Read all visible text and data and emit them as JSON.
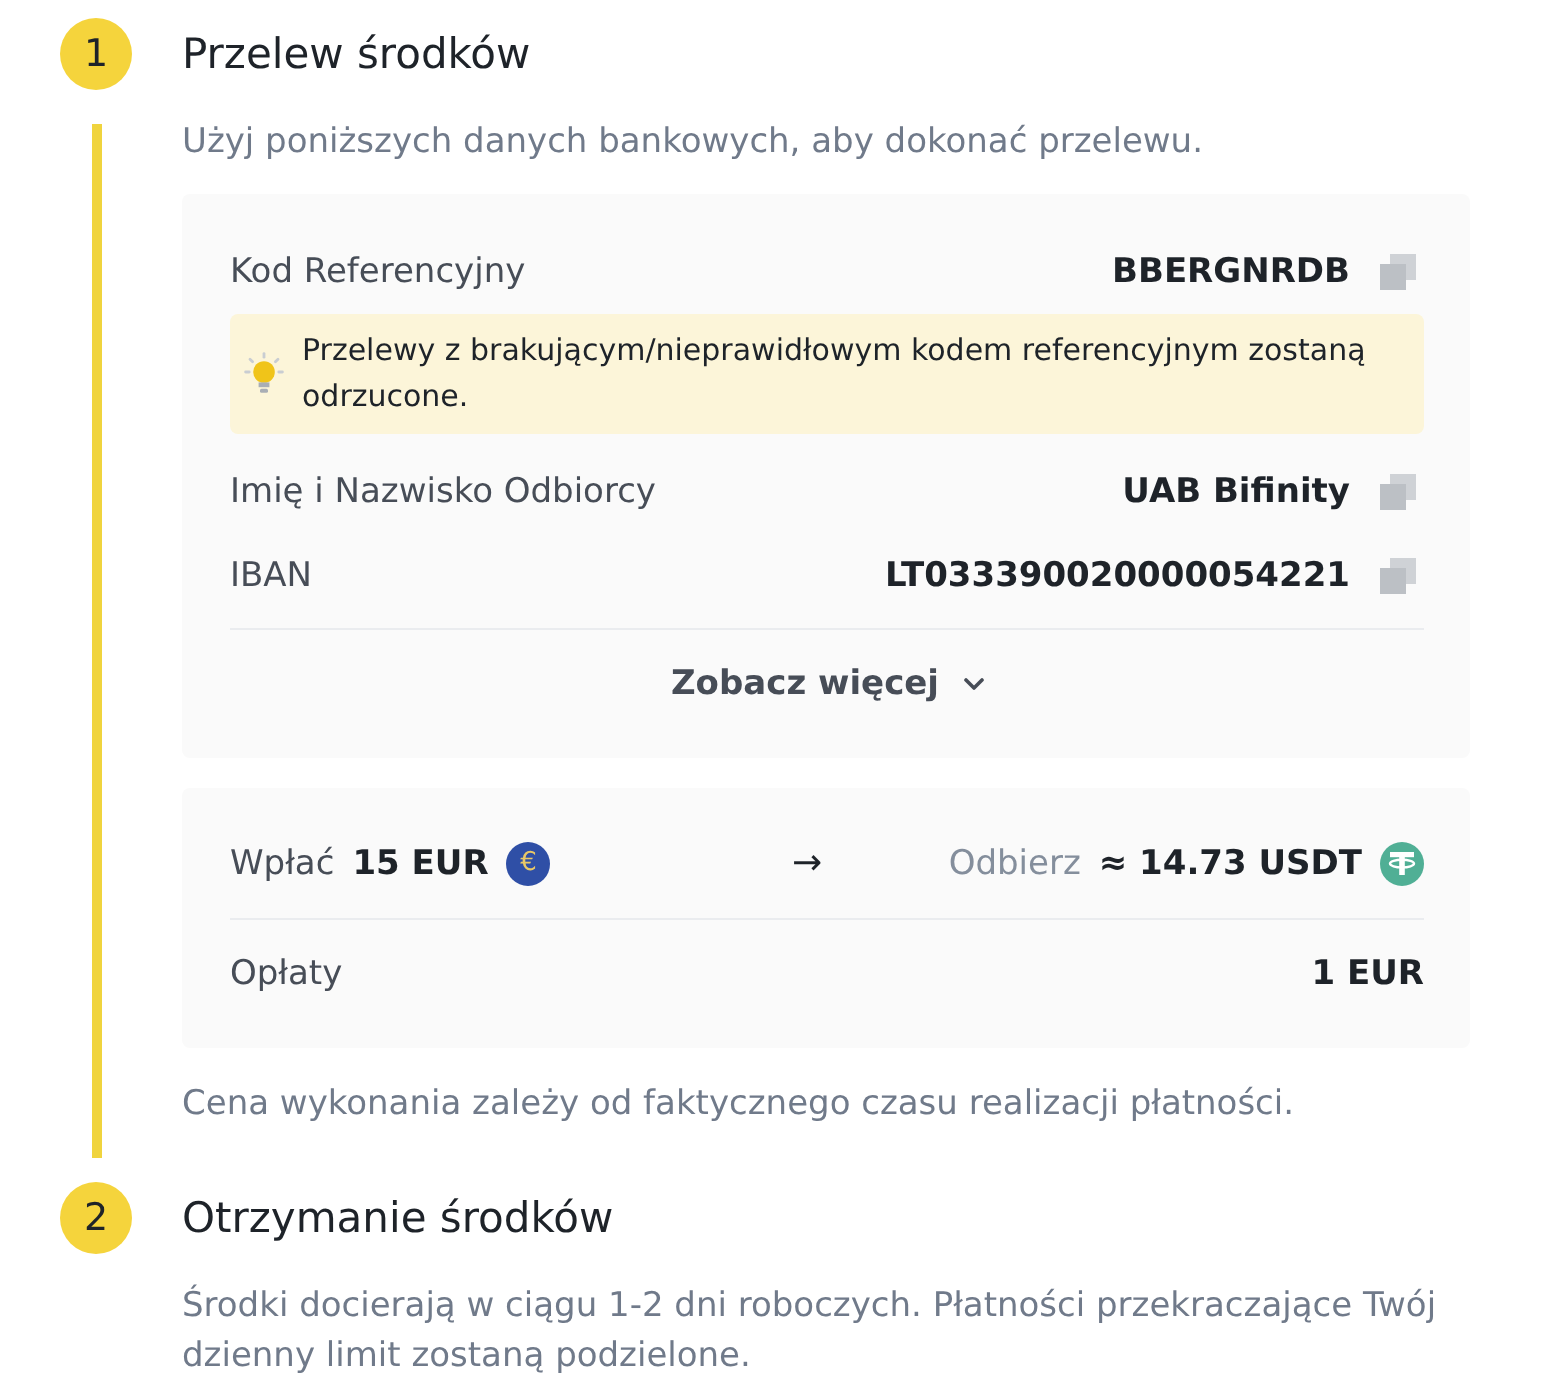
{
  "steps": [
    {
      "number": "1",
      "title": "Przelew środków",
      "description": "Użyj poniższych danych bankowych, aby dokonać przelewu.",
      "details": {
        "rows": [
          {
            "label": "Kod Referencyjny",
            "value": "BBERGNRDB",
            "notice": "Przelewy z brakującym/nieprawidłowym kodem referencyjnym zostaną odrzucone."
          },
          {
            "label": "Imię i Nazwisko Odbiorcy",
            "value": "UAB Bifinity"
          },
          {
            "label": "IBAN",
            "value": "LT033390020000054221"
          }
        ],
        "more_link": "Zobacz więcej"
      },
      "summary": {
        "deposit_label": "Wpłać",
        "deposit_amount": "15 EUR",
        "deposit_coin_glyph": "€",
        "arrow": "→",
        "receive_label": "Odbierz",
        "receive_amount": "≈ 14.73 USDT",
        "fees_label": "Opłaty",
        "fees_value": "1 EUR"
      },
      "note": "Cena wykonania zależy od faktycznego czasu realizacji płatności."
    },
    {
      "number": "2",
      "title": "Otrzymanie środków",
      "description": "Środki docierają w ciągu 1-2 dni roboczych. Płatności przekraczające Twój dzienny limit zostaną podzielone."
    }
  ]
}
